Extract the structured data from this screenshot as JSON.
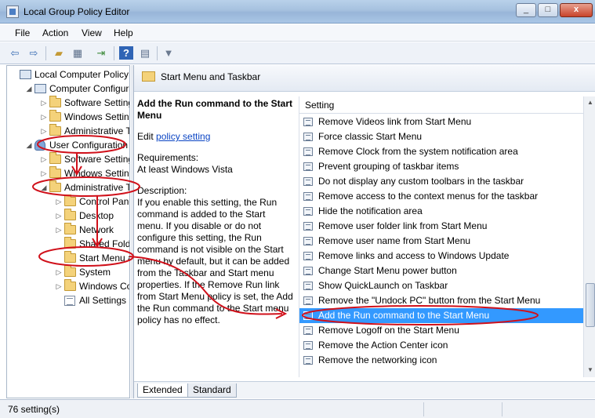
{
  "window": {
    "title": "Local Group Policy Editor",
    "min": "_",
    "max": "□",
    "close": "x"
  },
  "menu": [
    "File",
    "Action",
    "View",
    "Help"
  ],
  "toolbar": [
    "back-icon",
    "forward-icon",
    "up-folder-icon",
    "show-hide-tree-icon",
    "export-list-icon",
    "help-icon",
    "properties-icon",
    "filter-icon"
  ],
  "tree": [
    {
      "label": "Local Computer Policy",
      "depth": 0,
      "icon": "computer-icon",
      "expander": ""
    },
    {
      "label": "Computer Configura",
      "depth": 1,
      "icon": "computer-icon",
      "expander": "◢"
    },
    {
      "label": "Software Settings",
      "depth": 2,
      "icon": "folder-icon",
      "expander": "▷"
    },
    {
      "label": "Windows Setting",
      "depth": 2,
      "icon": "folder-icon",
      "expander": "▷"
    },
    {
      "label": "Administrative Te",
      "depth": 2,
      "icon": "folder-icon",
      "expander": "▷"
    },
    {
      "label": "User Configuration",
      "depth": 1,
      "icon": "user-icon",
      "expander": "◢"
    },
    {
      "label": "Software Settings",
      "depth": 2,
      "icon": "folder-icon",
      "expander": "▷"
    },
    {
      "label": "Windows Setting",
      "depth": 2,
      "icon": "folder-icon",
      "expander": "▷"
    },
    {
      "label": "Administrative Te",
      "depth": 2,
      "icon": "folder-icon",
      "expander": "◢"
    },
    {
      "label": "Control Panel",
      "depth": 3,
      "icon": "folder-icon",
      "expander": "▷"
    },
    {
      "label": "Desktop",
      "depth": 3,
      "icon": "folder-icon",
      "expander": "▷"
    },
    {
      "label": "Network",
      "depth": 3,
      "icon": "folder-icon",
      "expander": "▷"
    },
    {
      "label": "Shared Folder",
      "depth": 3,
      "icon": "folder-icon",
      "expander": ""
    },
    {
      "label": "Start Menu ar",
      "depth": 3,
      "icon": "folder-icon",
      "expander": ""
    },
    {
      "label": "System",
      "depth": 3,
      "icon": "folder-icon",
      "expander": "▷"
    },
    {
      "label": "Windows Cor",
      "depth": 3,
      "icon": "folder-icon",
      "expander": "▷"
    },
    {
      "label": "All Settings",
      "depth": 3,
      "icon": "list-icon",
      "expander": ""
    }
  ],
  "right_header": {
    "title": "Start Menu and Taskbar"
  },
  "description": {
    "title": "Add the Run command to the Start Menu",
    "edit_prefix": "Edit",
    "edit_link": "policy setting",
    "requirements_label": "Requirements:",
    "requirements_value": "At least Windows Vista",
    "description_label": "Description:",
    "description_text": "If you enable this setting, the Run command is added to the Start menu.  If you disable or do not configure this setting, the Run command is not visible on the Start menu by default, but it can be added from the Taskbar and Start menu properties. If the Remove Run link from Start Menu policy is set, the Add the Run command to the Start menu policy has no effect."
  },
  "list": {
    "column": "Setting",
    "rows": [
      "Remove Videos link from Start Menu",
      "Force classic Start Menu",
      "Remove Clock from the system notification area",
      "Prevent grouping of taskbar items",
      "Do not display any custom toolbars in the taskbar",
      "Remove access to the context menus for the taskbar",
      "Hide the notification area",
      "Remove user folder link from Start Menu",
      "Remove user name from Start Menu",
      "Remove links and access to Windows Update",
      "Change Start Menu power button",
      "Show QuickLaunch on Taskbar",
      "Remove the \"Undock PC\" button from the Start Menu",
      "Add the Run command to the Start Menu",
      "Remove Logoff on the Start Menu",
      "Remove the Action Center icon",
      "Remove the networking icon"
    ],
    "selected_index": 13,
    "scroll_up": "▲",
    "scroll_down": "▼"
  },
  "tabs": [
    "Extended",
    "Standard"
  ],
  "active_tab": 0,
  "status": {
    "text": "76 setting(s)"
  },
  "colors": {
    "selection": "#3399ff",
    "annotation": "#d0101a",
    "link": "#0b45c4"
  }
}
